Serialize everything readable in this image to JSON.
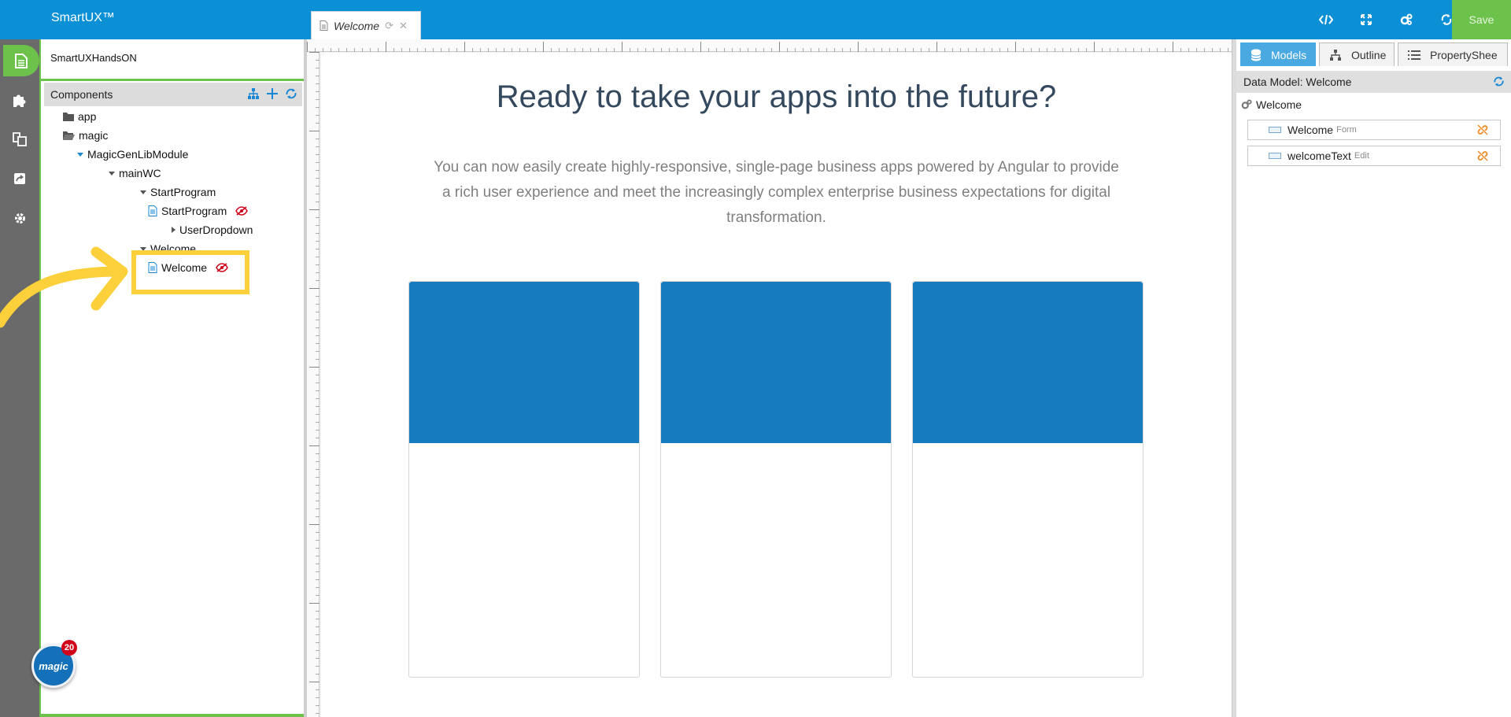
{
  "app": {
    "title": "SmartUX™"
  },
  "document_tab": {
    "label": "Welcome"
  },
  "toolbar": {
    "save_label": "Save"
  },
  "badge": {
    "brand": "magic",
    "count": "20"
  },
  "project": {
    "name": "SmartUXHandsON"
  },
  "components": {
    "title": "Components",
    "tree": [
      {
        "label": "app",
        "type": "folder"
      },
      {
        "label": "magic",
        "type": "folder-open"
      },
      {
        "label": "MagicGenLibModule",
        "type": "module"
      },
      {
        "label": "mainWC",
        "type": "group"
      },
      {
        "label": "StartProgram",
        "type": "group"
      },
      {
        "label": "StartProgram",
        "type": "form",
        "hidden": true
      },
      {
        "label": "UserDropdown",
        "type": "collapsed"
      },
      {
        "label": "Welcome",
        "type": "group"
      },
      {
        "label": "Welcome",
        "type": "form",
        "hidden": true
      }
    ]
  },
  "canvas": {
    "title": "Ready to take your apps into the future?",
    "body": "You can now easily create highly-responsive, single-page business apps powered by Angular to provide a rich user experience and meet the increasingly complex enterprise business expectations for digital transformation."
  },
  "right_panel": {
    "tabs": [
      "Models",
      "Outline",
      "PropertyShee"
    ],
    "model_title": "Data Model: Welcome",
    "root": "Welcome",
    "items": [
      {
        "name": "Welcome",
        "kind": "Form"
      },
      {
        "name": "welcomeText",
        "kind": "Edit"
      }
    ]
  },
  "colors": {
    "topbar": "#0b90d6",
    "accent_green": "#6cc24a",
    "card_blue": "#167cbf",
    "highlight_yellow": "#fcd03a",
    "hidden_red": "#d0021b"
  }
}
